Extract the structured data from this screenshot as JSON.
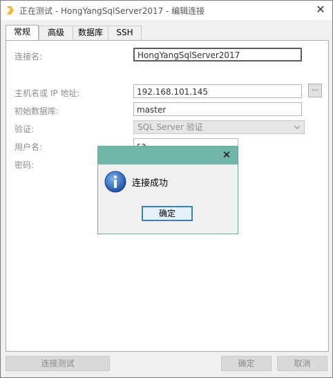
{
  "window": {
    "title": "正在测试 - HongYangSqlServer2017 - 编辑连接"
  },
  "tabs": [
    {
      "label": "常规",
      "active": true
    },
    {
      "label": "高级",
      "active": false
    },
    {
      "label": "数据库",
      "active": false
    },
    {
      "label": "SSH",
      "active": false
    }
  ],
  "form": {
    "connection_name_label": "连接名:",
    "connection_name_value": "HongYangSqlServer2017",
    "host_label": "主机名或 IP 地址:",
    "host_value": "192.168.101.145",
    "host_browse_label": "...",
    "initial_db_label": "初始数据库:",
    "initial_db_value": "master",
    "auth_label": "验证:",
    "auth_value": "SQL Server 验证",
    "username_label": "用户名:",
    "username_value": "sa",
    "password_label": "密码:"
  },
  "buttons": {
    "test_connection": "连接测试",
    "ok": "确定",
    "cancel": "取消"
  },
  "dialog": {
    "message": "连接成功",
    "ok_label": "确定"
  }
}
